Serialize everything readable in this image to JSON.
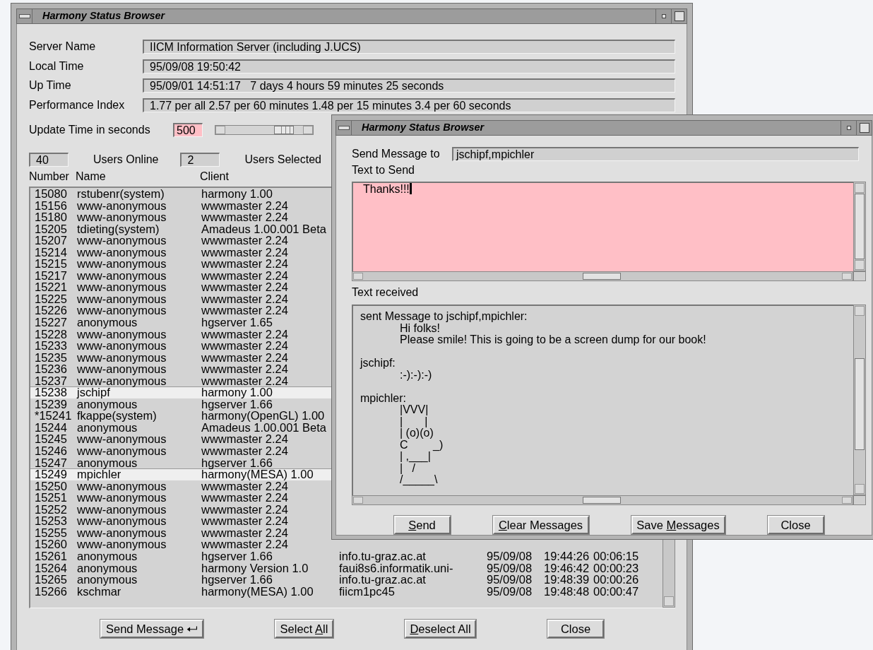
{
  "main_window": {
    "title": "Harmony Status Browser",
    "info": [
      {
        "label": "Server Name",
        "value": "IICM Information Server (including J.UCS)"
      },
      {
        "label": "Local Time",
        "value": "95/09/08 19:50:42"
      },
      {
        "label": "Up Time",
        "value": "95/09/01 14:51:17   7 days 4 hours 59 minutes 25 seconds"
      },
      {
        "label": "Performance Index",
        "value": "1.77 per all 2.57 per 60 minutes 1.48 per 15 minutes 3.4 per 60 seconds"
      }
    ],
    "update_time": {
      "label": "Update Time in seconds",
      "value": "500",
      "level": 0.88
    },
    "counts": [
      {
        "count": "40",
        "caption": "Users Online"
      },
      {
        "count": "2",
        "caption": "Users Selected"
      }
    ],
    "columns": [
      "Number",
      "Name",
      "Client"
    ],
    "rows": [
      {
        "number": "15080",
        "name": "rstubenr(system)",
        "client": "harmony 1.00",
        "selected": false
      },
      {
        "number": "15156",
        "name": "www-anonymous",
        "client": "wwwmaster 2.24",
        "selected": false
      },
      {
        "number": "15180",
        "name": "www-anonymous",
        "client": "wwwmaster 2.24",
        "selected": false
      },
      {
        "number": "15205",
        "name": "tdieting(system)",
        "client": "Amadeus 1.00.001 Beta",
        "selected": false
      },
      {
        "number": "15207",
        "name": "www-anonymous",
        "client": "wwwmaster 2.24",
        "selected": false
      },
      {
        "number": "15214",
        "name": "www-anonymous",
        "client": "wwwmaster 2.24",
        "selected": false
      },
      {
        "number": "15215",
        "name": "www-anonymous",
        "client": "wwwmaster 2.24",
        "selected": false
      },
      {
        "number": "15217",
        "name": "www-anonymous",
        "client": "wwwmaster 2.24",
        "selected": false
      },
      {
        "number": "15221",
        "name": "www-anonymous",
        "client": "wwwmaster 2.24",
        "selected": false
      },
      {
        "number": "15225",
        "name": "www-anonymous",
        "client": "wwwmaster 2.24",
        "selected": false
      },
      {
        "number": "15226",
        "name": "www-anonymous",
        "client": "wwwmaster 2.24",
        "selected": false
      },
      {
        "number": "15227",
        "name": "anonymous",
        "client": "hgserver 1.65",
        "selected": false
      },
      {
        "number": "15228",
        "name": "www-anonymous",
        "client": "wwwmaster 2.24",
        "selected": false
      },
      {
        "number": "15233",
        "name": "www-anonymous",
        "client": "wwwmaster 2.24",
        "selected": false
      },
      {
        "number": "15235",
        "name": "www-anonymous",
        "client": "wwwmaster 2.24",
        "selected": false
      },
      {
        "number": "15236",
        "name": "www-anonymous",
        "client": "wwwmaster 2.24",
        "selected": false
      },
      {
        "number": "15237",
        "name": "www-anonymous",
        "client": "wwwmaster 2.24",
        "selected": false
      },
      {
        "number": "15238",
        "name": "jschipf",
        "client": "harmony 1.00",
        "selected": true
      },
      {
        "number": "15239",
        "name": "anonymous",
        "client": "hgserver 1.66",
        "selected": false
      },
      {
        "number": "*15241",
        "name": "fkappe(system)",
        "client": "harmony(OpenGL) 1.00",
        "selected": false
      },
      {
        "number": "15244",
        "name": "anonymous",
        "client": "Amadeus 1.00.001 Beta",
        "selected": false
      },
      {
        "number": "15245",
        "name": "www-anonymous",
        "client": "wwwmaster 2.24",
        "selected": false
      },
      {
        "number": "15246",
        "name": "www-anonymous",
        "client": "wwwmaster 2.24",
        "selected": false
      },
      {
        "number": "15247",
        "name": "anonymous",
        "client": "hgserver 1.66",
        "selected": false
      },
      {
        "number": "15249",
        "name": "mpichler",
        "client": "harmony(MESA) 1.00",
        "selected": true
      },
      {
        "number": "15250",
        "name": "www-anonymous",
        "client": "wwwmaster 2.24",
        "selected": false
      },
      {
        "number": "15251",
        "name": "www-anonymous",
        "client": "wwwmaster 2.24",
        "selected": false
      },
      {
        "number": "15252",
        "name": "www-anonymous",
        "client": "wwwmaster 2.24",
        "selected": false
      },
      {
        "number": "15253",
        "name": "www-anonymous",
        "client": "wwwmaster 2.24",
        "selected": false
      },
      {
        "number": "15255",
        "name": "www-anonymous",
        "client": "wwwmaster 2.24",
        "selected": false
      },
      {
        "number": "15260",
        "name": "www-anonymous",
        "client": "wwwmaster 2.24",
        "selected": false
      },
      {
        "number": "15261",
        "name": "anonymous",
        "client": "hgserver 1.66",
        "host": "info.tu-graz.ac.at",
        "date": "95/09/08",
        "time": "19:44:26",
        "duration": "00:06:15",
        "selected": false
      },
      {
        "number": "15264",
        "name": "anonymous",
        "client": "harmony Version 1.0",
        "host": "faui8s6.informatik.uni-",
        "date": "95/09/08",
        "time": "19:46:42",
        "duration": "00:00:23",
        "selected": false
      },
      {
        "number": "15265",
        "name": "anonymous",
        "client": "hgserver 1.66",
        "host": "info.tu-graz.ac.at",
        "date": "95/09/08",
        "time": "19:48:39",
        "duration": "00:00:26",
        "selected": false
      },
      {
        "number": "15266",
        "name": "kschmar",
        "client": "harmony(MESA) 1.00",
        "host": "fiicm1pc45",
        "date": "95/09/08",
        "time": "19:48:48",
        "duration": "00:00:47",
        "selected": false
      }
    ],
    "buttons": [
      {
        "before": "Send Message"
      },
      {
        "before": "Select ",
        "mnemonic": "A",
        "after": "ll"
      },
      {
        "mnemonic": "D",
        "after": "eselect All"
      },
      {
        "before": "Close"
      }
    ]
  },
  "dialog": {
    "title": "Harmony Status Browser",
    "recipient_label": "Send Message to",
    "recipients": "jschipf,mpichler",
    "compose_label": "Text to Send",
    "compose_text": "Thanks!!!",
    "received_label": "Text received",
    "messages": [
      {
        "header": "sent Message to jschipf,mpichler:",
        "lines": [
          "Hi folks!",
          "Please smile! This is going to be a screen dump for our book!"
        ]
      },
      {
        "header": "jschipf:",
        "lines": [
          ":-):-):-)"
        ]
      },
      {
        "header": "mpichler:",
        "lines": [
          "|VVV|",
          "|       |",
          "| (o)(o)",
          "C        _)",
          "| ,___|",
          "|   /",
          "/_____\\"
        ]
      }
    ],
    "buttons": [
      {
        "mnemonic": "S",
        "after": "end"
      },
      {
        "mnemonic": "C",
        "after": "lear Messages"
      },
      {
        "before": "Save ",
        "mnemonic": "M",
        "after": "essages"
      },
      {
        "before": "Close"
      }
    ]
  }
}
